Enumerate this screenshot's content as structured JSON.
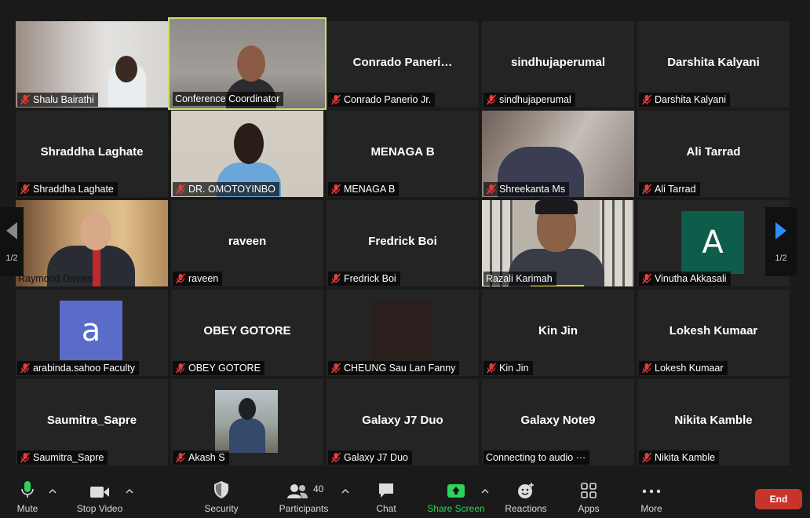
{
  "pager": {
    "page_left": "1/2",
    "page_right": "1/2"
  },
  "participants": [
    "Shalu Bairathi",
    "Conference Coordinator",
    "Conrado Panerio Jr.",
    "sindhujaperumal",
    "Darshita Kalyani",
    "Shraddha Laghate",
    "DR. OMOTOYINBO",
    "MENAGA B",
    "Shreekanta Ms",
    "Ali Tarrad",
    "Raymond Davies",
    "raveen",
    "Fredrick Boi",
    "Razali Karimah",
    "Vinutha Akkasali",
    "arabinda.sahoo Faculty",
    "OBEY GOTORE",
    "CHEUNG Sau Lan Fanny",
    "Kin Jin",
    "Lokesh Kumaar",
    "Saumitra_Sapre",
    "Akash S",
    "Galaxy J7 Duo",
    "Connecting to audio ···",
    "Nikita Kamble"
  ],
  "center_names": {
    "conrado": "Conrado  Paneri…",
    "sindhuja": "sindhujaperumal",
    "darshita": "Darshita Kalyani",
    "shraddha": "Shraddha Laghate",
    "menaga": "MENAGA B",
    "ali": "Ali Tarrad",
    "raveen": "raveen",
    "fredrick": "Fredrick Boi",
    "obey": "OBEY GOTORE",
    "kin": "Kin Jin",
    "lokesh": "Lokesh Kumaar",
    "saumitra": "Saumitra_Sapre",
    "galaxyj7": "Galaxy J7 Duo",
    "galaxynote": "Galaxy Note9",
    "nikita": "Nikita Kamble"
  },
  "avatars": {
    "vinutha": "A",
    "arabinda": "a"
  },
  "toolbar": {
    "mute": "Mute",
    "stop_video": "Stop Video",
    "security": "Security",
    "participants": "Participants",
    "participants_count": "40",
    "chat": "Chat",
    "share_screen": "Share Screen",
    "reactions": "Reactions",
    "apps": "Apps",
    "more": "More",
    "end": "End"
  },
  "colors": {
    "active_speaker": "#c8e06b",
    "share_green": "#2bd45a",
    "end_red": "#c8342c",
    "vinutha_avatar": "#0e5c4a",
    "arabinda_avatar": "#5a6cc8",
    "pager_arrow": "#2d8cff"
  },
  "icons": [
    "microphone-icon",
    "video-camera-icon",
    "shield-icon",
    "participants-icon",
    "chat-bubble-icon",
    "share-screen-icon",
    "reactions-icon",
    "apps-icon",
    "more-icon",
    "muted-mic-icon",
    "chevron-left-icon",
    "chevron-right-icon",
    "caret-up-icon"
  ]
}
